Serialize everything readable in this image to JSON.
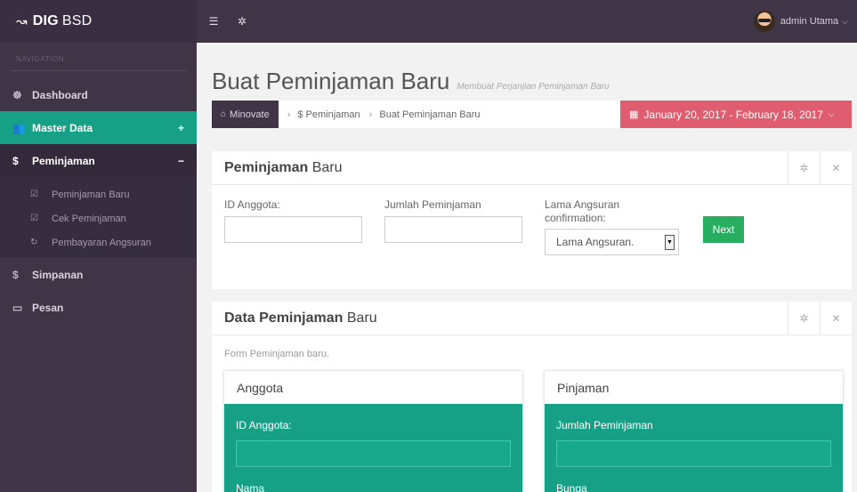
{
  "brand": {
    "name_bold": "DIG",
    "name_rest": "BSD"
  },
  "sidebar": {
    "heading": "NAVIGATION",
    "items": [
      {
        "label": "Dashboard",
        "icon": "tachometer-icon",
        "glyph": "☸"
      },
      {
        "label": "Master Data",
        "icon": "users-icon",
        "glyph": "👥",
        "sign": "+"
      },
      {
        "label": "Peminjaman",
        "icon": "dollar-icon",
        "glyph": "$",
        "sign": "−"
      },
      {
        "label": "Simpanan",
        "icon": "dollar-icon",
        "glyph": "$"
      },
      {
        "label": "Pesan",
        "icon": "inbox-icon",
        "glyph": "▭"
      }
    ],
    "subitems": [
      {
        "label": "Peminjaman Baru",
        "glyph": "☑"
      },
      {
        "label": "Cek Peminjaman",
        "glyph": "☑"
      },
      {
        "label": "Pembayaran Angsuran",
        "glyph": "↻"
      }
    ]
  },
  "topbar": {
    "user_name": "admin Utama"
  },
  "page": {
    "title": "Buat Peminjaman Baru",
    "subtitle": "Membuat Perjanjian Peminjaman Baru"
  },
  "breadcrumb": {
    "home": "Minovate",
    "level1": "$ Peminjaman",
    "level2": "Buat Peminjaman Baru"
  },
  "daterange": {
    "label": "January 20, 2017 - February 18, 2017"
  },
  "panel1": {
    "title_bold": "Peminjaman",
    "title_rest": " Baru",
    "fields": {
      "id_anggota": "ID Anggota:",
      "jumlah": "Jumlah Peminjaman",
      "lama_line1": "Lama Angsuran",
      "lama_line2": "confirmation:"
    },
    "select_value": "Lama Angsuran.",
    "next_label": "Next"
  },
  "panel2": {
    "title_bold": "Data Peminjaman",
    "title_rest": " Baru",
    "description": "Form Peminjaman baru.",
    "anggota": {
      "title": "Anggota",
      "label1": "ID Anggota:",
      "label2": "Nama"
    },
    "pinjaman": {
      "title": "Pinjaman",
      "label1": "Jumlah Peminjaman",
      "label2": "Bunga"
    }
  },
  "colors": {
    "sidebar_bg": "#3f3547",
    "accent_green": "#16a085",
    "date_red": "#e05d6f",
    "next_green": "#27ae60"
  }
}
